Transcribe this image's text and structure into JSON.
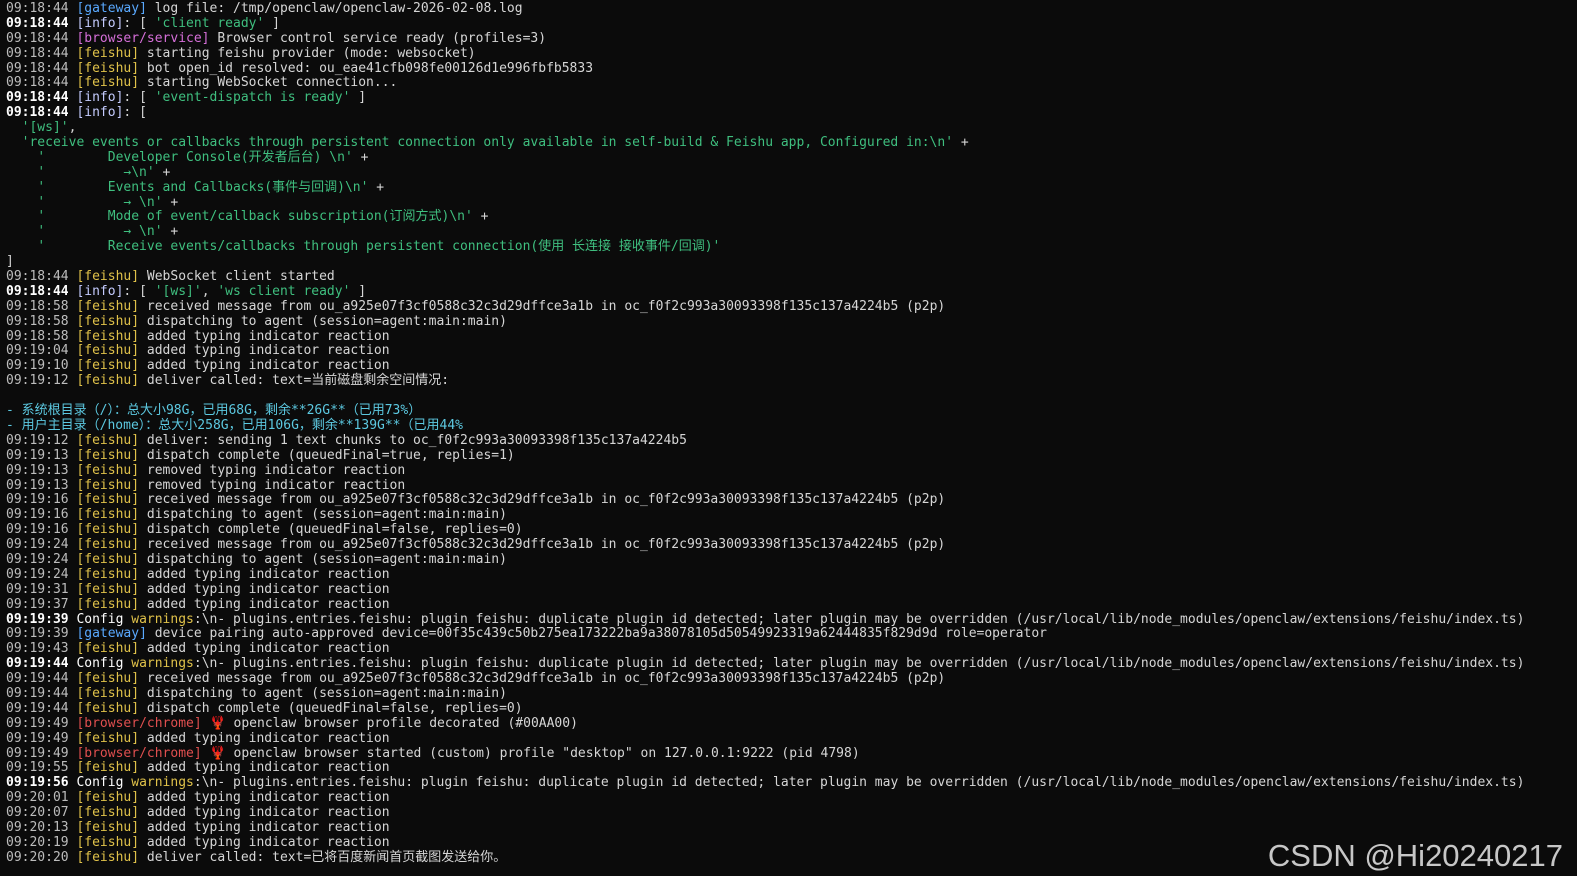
{
  "colors": {
    "background": "#0b0b0b",
    "gateway": "#5aa9ff",
    "info": "#c5ccff",
    "browser_service": "#d66fd9",
    "browser_chrome": "#e04f4f",
    "feishu": "#e0c24a",
    "green_string": "#3fbf7f",
    "cyan_text": "#5cc8e0"
  },
  "lines": [
    {
      "ts": "09:18:44",
      "tag": "[gateway]",
      "tag_class": "tag-gateway",
      "msg": " log file: /tmp/openclaw/openclaw-2026-02-08.log"
    },
    {
      "ts": "09:18:44",
      "bold": true,
      "tag": "[info]",
      "tag_class": "tag-info",
      "msg": ": [ ",
      "green": "'client ready'",
      "msg2": " ]"
    },
    {
      "ts": "09:18:44",
      "tag": "[browser/service]",
      "tag_class": "tag-browser-service",
      "msg": " Browser control service ready (profiles=3)"
    },
    {
      "ts": "09:18:44",
      "tag": "[feishu]",
      "tag_class": "tag-feishu",
      "msg": " starting feishu provider (mode: websocket)"
    },
    {
      "ts": "09:18:44",
      "tag": "[feishu]",
      "tag_class": "tag-feishu",
      "msg": " bot open_id resolved: ou_eae41cfb098fe00126d1e996fbfb5833"
    },
    {
      "ts": "09:18:44",
      "tag": "[feishu]",
      "tag_class": "tag-feishu",
      "msg": " starting WebSocket connection..."
    },
    {
      "ts": "09:18:44",
      "bold": true,
      "tag": "[info]",
      "tag_class": "tag-info",
      "msg": ": [ ",
      "green": "'event-dispatch is ready'",
      "msg2": " ]"
    },
    {
      "ts": "09:18:44",
      "bold": true,
      "tag": "[info]",
      "tag_class": "tag-info",
      "msg": ": ["
    },
    {
      "raw": "  ",
      "green": "'[ws]'",
      "msg2": ","
    },
    {
      "raw": "  ",
      "green": "'receive events or callbacks through persistent connection only available in self-build & Feishu app, Configured in:\\n'",
      "msg2": " +"
    },
    {
      "raw": "    ",
      "green": "'        Developer Console(开发者后台) \\n'",
      "msg2": " +"
    },
    {
      "raw": "    ",
      "green": "'          →\\n'",
      "msg2": " +"
    },
    {
      "raw": "    ",
      "green": "'        Events and Callbacks(事件与回调)\\n'",
      "msg2": " +"
    },
    {
      "raw": "    ",
      "green": "'          → \\n'",
      "msg2": " +"
    },
    {
      "raw": "    ",
      "green": "'        Mode of event/callback subscription(订阅方式)\\n'",
      "msg2": " +"
    },
    {
      "raw": "    ",
      "green": "'          → \\n'",
      "msg2": " +"
    },
    {
      "raw": "    ",
      "green": "'        Receive events/callbacks through persistent connection(使用 长连接 接收事件/回调)'"
    },
    {
      "raw": "]"
    },
    {
      "ts": "09:18:44",
      "tag": "[feishu]",
      "tag_class": "tag-feishu",
      "msg": " WebSocket client started"
    },
    {
      "ts": "09:18:44",
      "bold": true,
      "tag": "[info]",
      "tag_class": "tag-info",
      "msg": ": [ ",
      "green": "'[ws]'",
      "msg2": ", ",
      "green2": "'ws client ready'",
      "msg3": " ]"
    },
    {
      "ts": "09:18:58",
      "tag": "[feishu]",
      "tag_class": "tag-feishu",
      "msg": " received message from ou_a925e07f3cf0588c32c3d29dffce3a1b in oc_f0f2c993a30093398f135c137a4224b5 (p2p)"
    },
    {
      "ts": "09:18:58",
      "tag": "[feishu]",
      "tag_class": "tag-feishu",
      "msg": " dispatching to agent (session=agent:main:main)"
    },
    {
      "ts": "09:18:58",
      "tag": "[feishu]",
      "tag_class": "tag-feishu",
      "msg": " added typing indicator reaction"
    },
    {
      "ts": "09:19:04",
      "tag": "[feishu]",
      "tag_class": "tag-feishu",
      "msg": " added typing indicator reaction"
    },
    {
      "ts": "09:19:10",
      "tag": "[feishu]",
      "tag_class": "tag-feishu",
      "msg": " added typing indicator reaction"
    },
    {
      "ts": "09:19:12",
      "tag": "[feishu]",
      "tag_class": "tag-feishu",
      "msg": " deliver called: text=当前磁盘剩余空间情况:"
    },
    {
      "raw": ""
    },
    {
      "cyan": "- 系统根目录（/）：总大小98G，已用68G，剩余**26G**（已用73%）"
    },
    {
      "cyan": "- 用户主目录（/home）：总大小258G，已用106G，剩余**139G**（已用44%"
    },
    {
      "ts": "09:19:12",
      "tag": "[feishu]",
      "tag_class": "tag-feishu",
      "msg": " deliver: sending 1 text chunks to oc_f0f2c993a30093398f135c137a4224b5"
    },
    {
      "ts": "09:19:13",
      "tag": "[feishu]",
      "tag_class": "tag-feishu",
      "msg": " dispatch complete (queuedFinal=true, replies=1)"
    },
    {
      "ts": "09:19:13",
      "tag": "[feishu]",
      "tag_class": "tag-feishu",
      "msg": " removed typing indicator reaction"
    },
    {
      "ts": "09:19:13",
      "tag": "[feishu]",
      "tag_class": "tag-feishu",
      "msg": " removed typing indicator reaction"
    },
    {
      "ts": "09:19:16",
      "tag": "[feishu]",
      "tag_class": "tag-feishu",
      "msg": " received message from ou_a925e07f3cf0588c32c3d29dffce3a1b in oc_f0f2c993a30093398f135c137a4224b5 (p2p)"
    },
    {
      "ts": "09:19:16",
      "tag": "[feishu]",
      "tag_class": "tag-feishu",
      "msg": " dispatching to agent (session=agent:main:main)"
    },
    {
      "ts": "09:19:16",
      "tag": "[feishu]",
      "tag_class": "tag-feishu",
      "msg": " dispatch complete (queuedFinal=false, replies=0)"
    },
    {
      "ts": "09:19:24",
      "tag": "[feishu]",
      "tag_class": "tag-feishu",
      "msg": " received message from ou_a925e07f3cf0588c32c3d29dffce3a1b in oc_f0f2c993a30093398f135c137a4224b5 (p2p)"
    },
    {
      "ts": "09:19:24",
      "tag": "[feishu]",
      "tag_class": "tag-feishu",
      "msg": " dispatching to agent (session=agent:main:main)"
    },
    {
      "ts": "09:19:24",
      "tag": "[feishu]",
      "tag_class": "tag-feishu",
      "msg": " added typing indicator reaction"
    },
    {
      "ts": "09:19:31",
      "tag": "[feishu]",
      "tag_class": "tag-feishu",
      "msg": " added typing indicator reaction"
    },
    {
      "ts": "09:19:37",
      "tag": "[feishu]",
      "tag_class": "tag-feishu",
      "msg": " added typing indicator reaction"
    },
    {
      "ts": "09:19:39",
      "bold": true,
      "tag": "Config",
      "tag_class": "tag-config",
      "msg": " ",
      "warn": "warnings",
      "msg2": ":\\n- plugins.entries.feishu: plugin feishu: duplicate plugin id detected; later plugin may be overridden (/usr/local/lib/node_modules/openclaw/extensions/feishu/index.ts)"
    },
    {
      "ts": "09:19:39",
      "tag": "[gateway]",
      "tag_class": "tag-gateway",
      "msg": " device pairing auto-approved device=00f35c439c50b275ea173222ba9a38078105d50549923319a62444835f829d9d role=operator"
    },
    {
      "ts": "09:19:43",
      "tag": "[feishu]",
      "tag_class": "tag-feishu",
      "msg": " added typing indicator reaction"
    },
    {
      "ts": "09:19:44",
      "bold": true,
      "tag": "Config",
      "tag_class": "tag-config",
      "msg": " ",
      "warn": "warnings",
      "msg2": ":\\n- plugins.entries.feishu: plugin feishu: duplicate plugin id detected; later plugin may be overridden (/usr/local/lib/node_modules/openclaw/extensions/feishu/index.ts)"
    },
    {
      "ts": "09:19:44",
      "tag": "[feishu]",
      "tag_class": "tag-feishu",
      "msg": " received message from ou_a925e07f3cf0588c32c3d29dffce3a1b in oc_f0f2c993a30093398f135c137a4224b5 (p2p)"
    },
    {
      "ts": "09:19:44",
      "tag": "[feishu]",
      "tag_class": "tag-feishu",
      "msg": " dispatching to agent (session=agent:main:main)"
    },
    {
      "ts": "09:19:44",
      "tag": "[feishu]",
      "tag_class": "tag-feishu",
      "msg": " dispatch complete (queuedFinal=false, replies=0)"
    },
    {
      "ts": "09:19:49",
      "tag": "[browser/chrome]",
      "tag_class": "tag-browser-chrome",
      "msg": " 🦞 openclaw browser profile decorated (#00AA00)"
    },
    {
      "ts": "09:19:49",
      "tag": "[feishu]",
      "tag_class": "tag-feishu",
      "msg": " added typing indicator reaction"
    },
    {
      "ts": "09:19:49",
      "tag": "[browser/chrome]",
      "tag_class": "tag-browser-chrome",
      "msg": " 🦞 openclaw browser started (custom) profile \"desktop\" on 127.0.0.1:9222 (pid 4798)"
    },
    {
      "ts": "09:19:55",
      "tag": "[feishu]",
      "tag_class": "tag-feishu",
      "msg": " added typing indicator reaction"
    },
    {
      "ts": "09:19:56",
      "bold": true,
      "tag": "Config",
      "tag_class": "tag-config",
      "msg": " ",
      "warn": "warnings",
      "msg2": ":\\n- plugins.entries.feishu: plugin feishu: duplicate plugin id detected; later plugin may be overridden (/usr/local/lib/node_modules/openclaw/extensions/feishu/index.ts)"
    },
    {
      "ts": "09:20:01",
      "tag": "[feishu]",
      "tag_class": "tag-feishu",
      "msg": " added typing indicator reaction"
    },
    {
      "ts": "09:20:07",
      "tag": "[feishu]",
      "tag_class": "tag-feishu",
      "msg": " added typing indicator reaction"
    },
    {
      "ts": "09:20:13",
      "tag": "[feishu]",
      "tag_class": "tag-feishu",
      "msg": " added typing indicator reaction"
    },
    {
      "ts": "09:20:19",
      "tag": "[feishu]",
      "tag_class": "tag-feishu",
      "msg": " added typing indicator reaction"
    },
    {
      "ts": "09:20:20",
      "tag": "[feishu]",
      "tag_class": "tag-feishu",
      "msg": " deliver called: text=已将百度新闻首页截图发送给你。"
    }
  ],
  "watermark": "CSDN @Hi20240217"
}
